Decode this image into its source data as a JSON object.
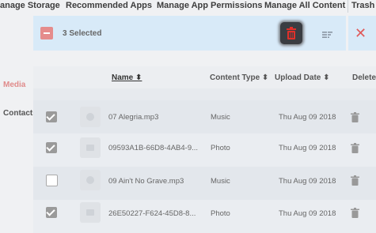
{
  "nav": {
    "items": [
      {
        "label": "anage Storage"
      },
      {
        "label": "Recommended Apps"
      },
      {
        "label": "Manage App Permissions"
      },
      {
        "label": "Manage All Content"
      },
      {
        "label": "Trash"
      }
    ]
  },
  "sidebar": {
    "items": [
      {
        "label": "Media",
        "active": true
      },
      {
        "label": "Contacts",
        "active": false
      }
    ]
  },
  "selection": {
    "count_text": "3 Selected",
    "delete_icon": "trash-icon",
    "sort_icon": "sort-lines-icon",
    "close_icon": "close-icon"
  },
  "table": {
    "headers": {
      "name": "Name ⬍",
      "type": "Content Type ⬍",
      "date": "Upload Date ⬍",
      "delete": "Delete"
    },
    "rows": [
      {
        "checked": true,
        "name": "07 Alegria.mp3",
        "type": "Music",
        "date": "Thu Aug 09 2018",
        "thumb": "music"
      },
      {
        "checked": true,
        "name": "09593A1B-66D8-4AB4-9...",
        "type": "Photo",
        "date": "Thu Aug 09 2018",
        "thumb": "photo"
      },
      {
        "checked": false,
        "name": "09 Ain't No Grave.mp3",
        "type": "Music",
        "date": "Thu Aug 09 2018",
        "thumb": "music"
      },
      {
        "checked": true,
        "name": "26E50227-F624-45D8-8...",
        "type": "Photo",
        "date": "Thu Aug 09 2018",
        "thumb": "photo"
      }
    ]
  },
  "colors": {
    "accent_red": "#e58c8c",
    "selection_bar": "#d8eaf8",
    "close_red": "#e05a5a"
  }
}
